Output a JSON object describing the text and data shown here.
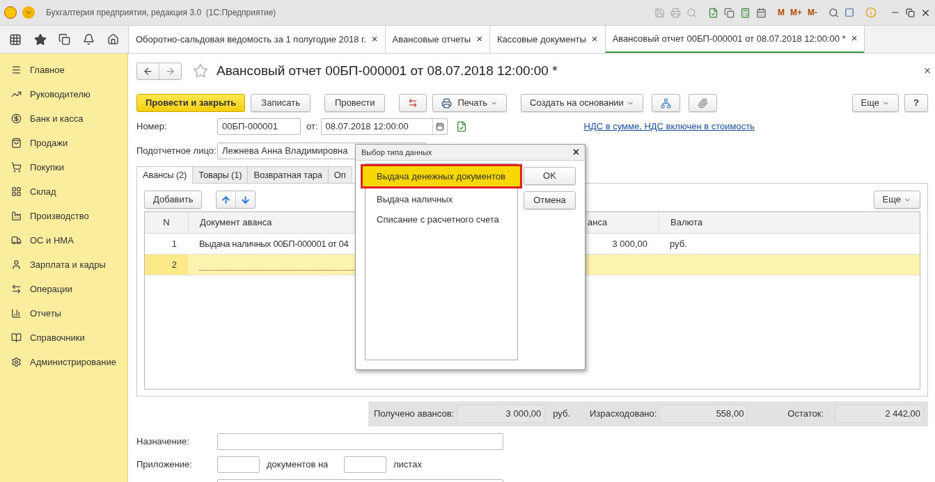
{
  "window": {
    "title": "Бухгалтерия предприятия, редакция 3.0  (1С:Предприятие)",
    "memory_buttons": [
      "M",
      "M+",
      "M-"
    ]
  },
  "tabs": [
    {
      "label": "Оборотно-сальдовая ведомость за 1 полугодие 2018 г.",
      "close": "×",
      "selected": false
    },
    {
      "label": "Авансовые отчеты",
      "close": "×",
      "selected": false
    },
    {
      "label": "Кассовые документы",
      "close": "×",
      "selected": false
    },
    {
      "label": "Авансовый отчет 00БП-000001 от 08.07.2018 12:00:00 *",
      "close": "×",
      "selected": true
    }
  ],
  "sidebar": {
    "items": [
      {
        "label": "Главное"
      },
      {
        "label": "Руководителю"
      },
      {
        "label": "Банк и касса"
      },
      {
        "label": "Продажи"
      },
      {
        "label": "Покупки"
      },
      {
        "label": "Склад"
      },
      {
        "label": "Производство"
      },
      {
        "label": "ОС и НМА"
      },
      {
        "label": "Зарплата и кадры"
      },
      {
        "label": "Операции"
      },
      {
        "label": "Отчеты"
      },
      {
        "label": "Справочники"
      },
      {
        "label": "Администрирование"
      }
    ]
  },
  "document": {
    "title": "Авансовый отчет 00БП-000001 от 08.07.2018 12:00:00 *",
    "close": "×",
    "toolbar": [
      {
        "kind": "primary",
        "label": "Провести и закрыть"
      },
      {
        "kind": "plain",
        "label": "Записать"
      },
      {
        "kind": "plain",
        "label": "Провести"
      },
      {
        "kind": "dtkt"
      },
      {
        "kind": "print",
        "label": "Печать"
      },
      {
        "kind": "menu",
        "label": "Создать на основании"
      },
      {
        "kind": "structure"
      },
      {
        "kind": "attach"
      }
    ],
    "more": "Еще",
    "help": "?",
    "number_label": "Номер:",
    "number": "00БП-000001",
    "date_label": "от:",
    "date": "08.07.2018 12:00:00",
    "vat_link": "НДС в сумме, НДС включен в стоимость",
    "person_label": "Подотчетное лицо:",
    "person": "Лежнева Анна Владимировна",
    "tabs": [
      {
        "label": "Авансы (2)",
        "selected": true
      },
      {
        "label": "Товары (1)",
        "selected": false
      },
      {
        "label": "Возвратная тара",
        "selected": false
      },
      {
        "label": "Оп",
        "selected": false
      }
    ],
    "add": "Добавить",
    "table_more": "Еще",
    "table": {
      "columns": [
        "N",
        "Документ аванса",
        "анса",
        "Валюта"
      ],
      "rows": [
        {
          "n": "1",
          "document": "Выдача наличных 00БП-000001 от 04",
          "amount": "3 000,00",
          "currency": "руб.",
          "selected": false,
          "error": false
        },
        {
          "n": "2",
          "document": "",
          "amount": "",
          "currency": "",
          "selected": true,
          "error": true
        }
      ]
    },
    "totals": {
      "received_label": "Получено авансов:",
      "received": "3 000,00",
      "currency": "руб.",
      "spent_label": "Израсходовано:",
      "spent": "558,00",
      "rest_label": "Остаток:",
      "rest": "2 442,00"
    },
    "purpose_label": "Назначение:",
    "attachment_label": "Приложение:",
    "documents_on": "документов на",
    "sheets": "листах"
  },
  "dialog": {
    "title": "Выбор типа данных",
    "close": "×",
    "items": [
      {
        "label": "Выдача денежных документов",
        "selected": true
      },
      {
        "label": "Выдача наличных",
        "selected": false
      },
      {
        "label": "Списание с расчетного счета",
        "selected": false
      }
    ],
    "ok": "OK",
    "cancel": "Отмена"
  }
}
